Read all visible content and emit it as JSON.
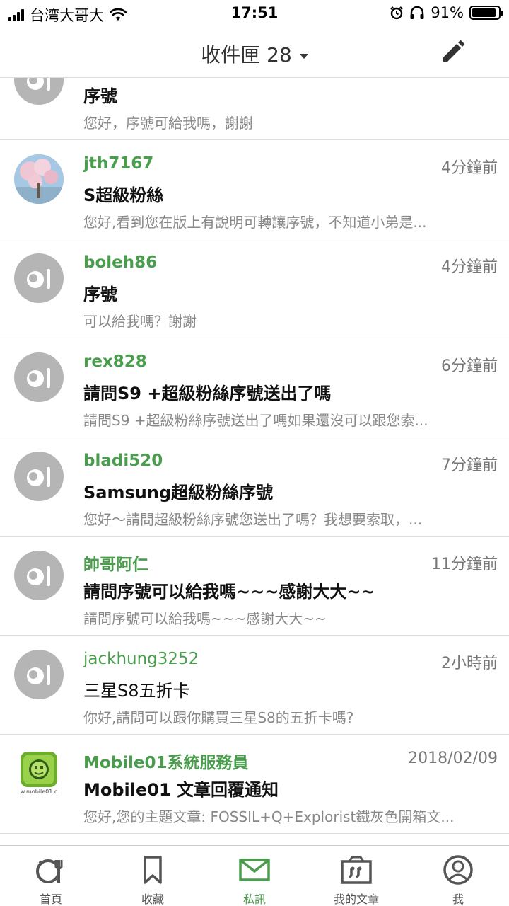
{
  "status_bar": {
    "carrier": "台湾大哥大",
    "time": "17:51",
    "battery": "91%",
    "battery_level": 0.91
  },
  "header": {
    "title": "收件匣 28"
  },
  "messages": [
    {
      "sender": "",
      "time": "",
      "subject": "序號",
      "preview": "您好，序號可給我嗎，謝謝",
      "avatar": "default-avatar-icon"
    },
    {
      "sender": "jth7167",
      "time": "4分鐘前",
      "subject": "S超級粉絲",
      "preview": "您好,看到您在版上有說明可轉讓序號，不知道小弟是...",
      "avatar": "cherry-blossom-photo"
    },
    {
      "sender": "boleh86",
      "time": "4分鐘前",
      "subject": "序號",
      "preview": "可以給我嗎？謝謝",
      "avatar": "default-avatar-icon"
    },
    {
      "sender": "rex828",
      "time": "6分鐘前",
      "subject": "請問S9 +超級粉絲序號送出了嗎",
      "preview": "請問S9 +超級粉絲序號送出了嗎如果還沒可以跟您索...",
      "avatar": "default-avatar-icon"
    },
    {
      "sender": "bladi520",
      "time": "7分鐘前",
      "subject": "Samsung超級粉絲序號",
      "preview": "您好～請問超級粉絲序號您送出了嗎？我想要索取，...",
      "avatar": "default-avatar-icon"
    },
    {
      "sender": "帥哥阿仁",
      "time": "11分鐘前",
      "subject": "請問序號可以給我嗎~~~感謝大大~~",
      "preview": "請問序號可以給我嗎~~~感謝大大~~",
      "avatar": "default-avatar-icon"
    },
    {
      "sender": "jackhung3252",
      "time": "2小時前",
      "subject": "三星S8五折卡",
      "preview": "你好,請問可以跟你購買三星S8的五折卡嗎?",
      "avatar": "default-avatar-icon"
    },
    {
      "sender": "Mobile01系統服務員",
      "time": "2018/02/09",
      "subject": "Mobile01 文章回覆通知",
      "preview": "您好,您的主題文章: FOSSIL+Q+Explorist鐵灰色開箱文...",
      "avatar": "mobile01-logo",
      "logo_text": "w.mobile01.c"
    }
  ],
  "tabs": [
    {
      "label": "首頁",
      "icon": "home-icon"
    },
    {
      "label": "收藏",
      "icon": "bookmark-icon"
    },
    {
      "label": "私訊",
      "icon": "mail-icon",
      "active": true
    },
    {
      "label": "我的文章",
      "icon": "articles-icon"
    },
    {
      "label": "我",
      "icon": "profile-icon"
    }
  ],
  "colors": {
    "accent": "#4a9d4d",
    "avatar_gray": "#b5b5b5"
  }
}
